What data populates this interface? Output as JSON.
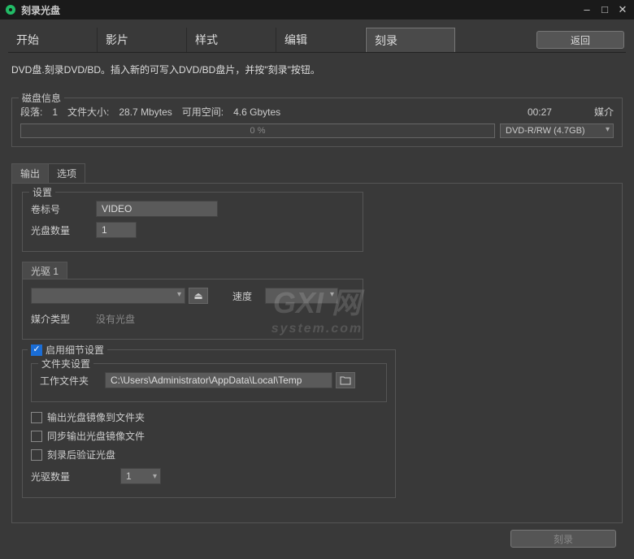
{
  "titlebar": {
    "title": "刻录光盘"
  },
  "tabs": {
    "items": [
      "开始",
      "影片",
      "样式",
      "编辑",
      "刻录"
    ],
    "active": 4,
    "return_label": "返回"
  },
  "description": "DVD盘.刻录DVD/BD。插入新的可写入DVD/BD盘片，并按\"刻录\"按钮。",
  "disc_info": {
    "legend": "磁盘信息",
    "segments_label": "段落:",
    "segments": "1",
    "filesize_label": "文件大小:",
    "filesize": "28.7 Mbytes",
    "available_label": "可用空间:",
    "available": "4.6 Gbytes",
    "time": "00:27",
    "media_label": "媒介",
    "progress_pct": "0 %",
    "media_selected": "DVD-R/RW (4.7GB)"
  },
  "subtabs": {
    "items": [
      "输出",
      "选项"
    ],
    "active": 0
  },
  "settings": {
    "legend": "设置",
    "volume_label": "卷标号",
    "volume_value": "VIDEO",
    "copies_label": "光盘数量",
    "copies_value": "1"
  },
  "drive": {
    "legend": "光驱 1",
    "eject_icon": "⏏",
    "speed_label": "速度",
    "media_type_label": "媒介类型",
    "media_type_value": "没有光盘"
  },
  "detail": {
    "enable_label": "启用细节设置",
    "folder_legend": "文件夹设置",
    "work_folder_label": "工作文件夹",
    "work_folder_value": "C:\\Users\\Administrator\\AppData\\Local\\Temp",
    "cb_output_folder": "输出光盘镜像到文件夹",
    "cb_sync_output": "同步输出光盘镜像文件",
    "cb_verify": "刻录后验证光盘",
    "drive_count_label": "光驱数量",
    "drive_count_value": "1"
  },
  "footer": {
    "burn_label": "刻录"
  },
  "watermark": {
    "main": "GXI 网",
    "sub": "system.com"
  }
}
